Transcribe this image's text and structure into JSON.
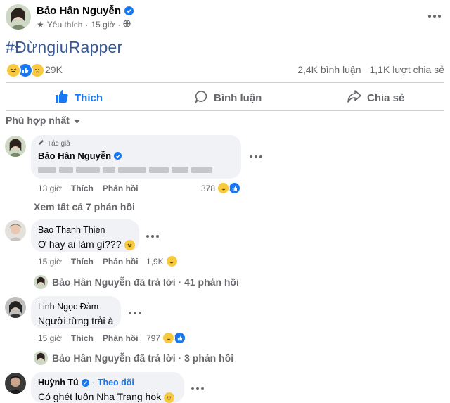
{
  "post": {
    "author": "Bảo Hân Nguyễn",
    "meta_label": "Yêu thích",
    "meta_dot": "·",
    "meta_time": "15 giờ",
    "hashtag": "#ĐừngiuRapper",
    "reaction_count": "29K",
    "comments_count": "2,4K bình luận",
    "shares_count": "1,1K lượt chia sẻ",
    "reaction_icons": [
      "haha-icon",
      "like-icon",
      "sad-icon"
    ]
  },
  "actions": {
    "like": "Thích",
    "comment": "Bình luận",
    "share": "Chia sẻ"
  },
  "sort_label": "Phù hợp nhất",
  "comments": [
    {
      "author_badge": "Tác giả",
      "author": "Bảo Hân Nguyễn",
      "time": "13 giờ",
      "like": "Thích",
      "reply": "Phản hồi",
      "reaction_count": "378"
    },
    {
      "author": "Bao Thanh Thien",
      "text": "Ơ hay ai làm gì???",
      "time": "15 giờ",
      "like": "Thích",
      "reply": "Phản hồi",
      "reaction_count": "1,9K"
    },
    {
      "author": "Linh Ngọc Đàm",
      "text": "Người từng trải à",
      "time": "15 giờ",
      "like": "Thích",
      "reply": "Phản hồi",
      "reaction_count": "797"
    },
    {
      "author": "Huỳnh Tú",
      "follow": "Theo dõi",
      "text": "Có ghét luôn Nha Trang hok"
    }
  ],
  "see_all_replies": "Xem tất cả 7 phản hồi",
  "reply_summaries": [
    "Bảo Hân Nguyễn đã trả lời · 41 phản hồi",
    "Bảo Hân Nguyễn đã trả lời · 3 phản hồi"
  ],
  "colors": {
    "accent": "#1877f2",
    "hashtag": "#385898",
    "secondary_text": "#65676b",
    "bubble": "#f0f2f5"
  }
}
